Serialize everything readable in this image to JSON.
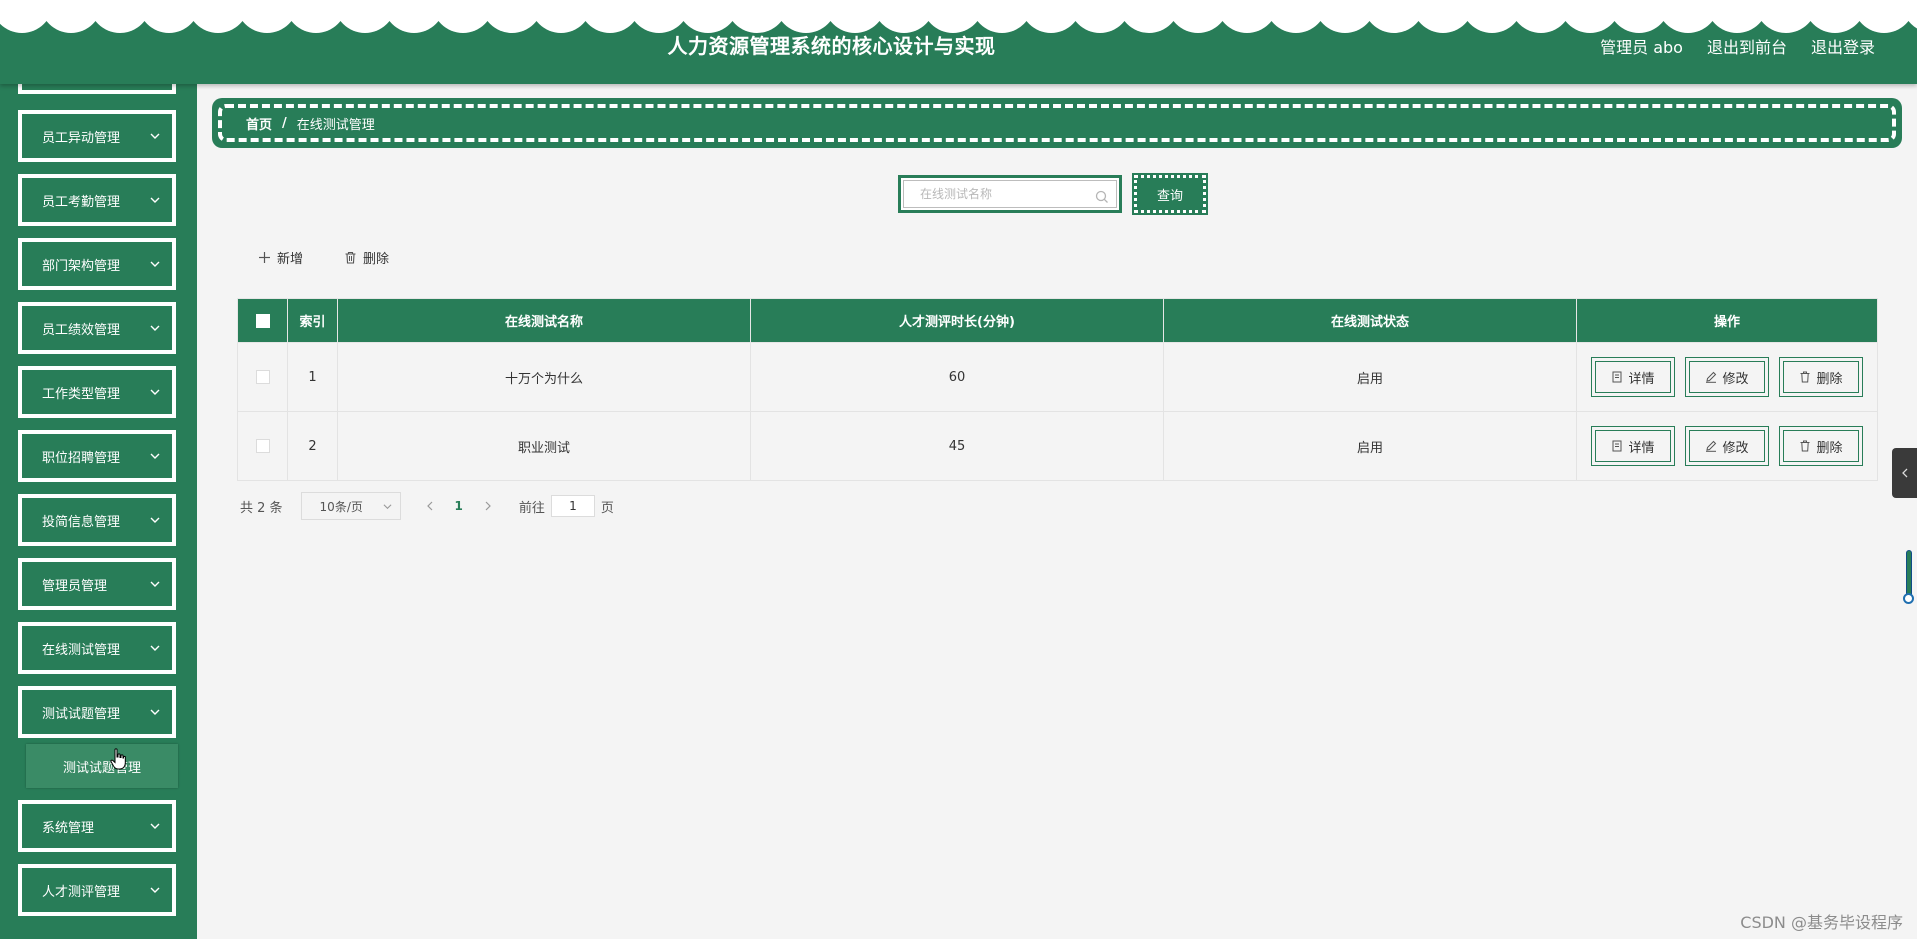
{
  "header": {
    "title": "人力资源管理系统的核心设计与实现",
    "user_label": "管理员 abo",
    "to_front_label": "退出到前台",
    "logout_label": "退出登录"
  },
  "sidebar": {
    "items": [
      {
        "label": "员工异动管理"
      },
      {
        "label": "员工考勤管理"
      },
      {
        "label": "部门架构管理"
      },
      {
        "label": "员工绩效管理"
      },
      {
        "label": "工作类型管理"
      },
      {
        "label": "职位招聘管理"
      },
      {
        "label": "投简信息管理"
      },
      {
        "label": "管理员管理"
      },
      {
        "label": "在线测试管理"
      },
      {
        "label": "测试试题管理"
      },
      {
        "label": "系统管理"
      },
      {
        "label": "人才测评管理"
      }
    ],
    "open_submenu_label": "测试试题管理"
  },
  "breadcrumb": {
    "home": "首页",
    "separator": "/",
    "current": "在线测试管理"
  },
  "search": {
    "placeholder": "在线测试名称",
    "value": "",
    "button_label": "查询"
  },
  "toolbar": {
    "add_label": "新增",
    "delete_label": "删除"
  },
  "table": {
    "headers": [
      "索引",
      "在线测试名称",
      "人才测评时长(分钟)",
      "在线测试状态",
      "操作"
    ],
    "rows": [
      {
        "index": "1",
        "name": "十万个为什么",
        "duration": "60",
        "status": "启用"
      },
      {
        "index": "2",
        "name": "职业测试",
        "duration": "45",
        "status": "启用"
      }
    ],
    "row_actions": {
      "detail": "详情",
      "edit": "修改",
      "delete": "删除"
    }
  },
  "pagination": {
    "total_text": "共 2 条",
    "page_size": "10条/页",
    "current_page": "1",
    "goto_label": "前往",
    "goto_value": "1",
    "goto_suffix": "页"
  },
  "watermark": "CSDN @基务毕设程序",
  "colors": {
    "primary": "#287d58",
    "background": "#f4f4f4"
  }
}
